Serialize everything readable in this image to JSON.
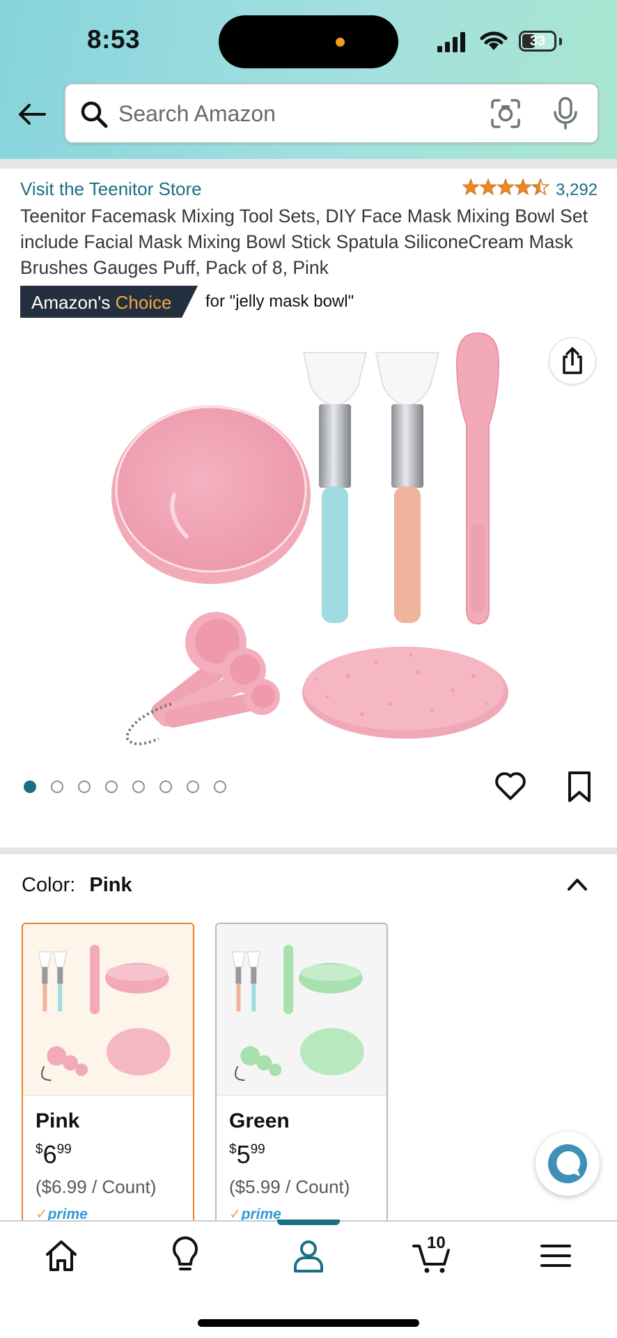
{
  "status_bar": {
    "time": "8:53",
    "battery": "33"
  },
  "search": {
    "placeholder": "Search Amazon"
  },
  "product": {
    "store_link": "Visit the Teenitor Store",
    "rating": 4.5,
    "rating_count": "3,292",
    "title": "Teenitor Facemask Mixing Tool Sets, DIY Face Mask Mixing Bowl Set include Facial Mask Mixing Bowl Stick Spatula SiliconeCream Mask Brushes Gauges Puff, Pack of 8, Pink",
    "badge": {
      "prefix": "Amazon's",
      "highlight": "Choice",
      "for_text": "for \"jelly mask bowl\""
    },
    "image_count": 8,
    "active_image": 0
  },
  "color": {
    "label": "Color:",
    "selected": "Pink",
    "options": [
      {
        "name": "Pink",
        "currency": "$",
        "whole": "6",
        "fraction": "99",
        "unit_price": "($6.99 / Count)",
        "prime": "prime"
      },
      {
        "name": "Green",
        "currency": "$",
        "whole": "5",
        "fraction": "99",
        "unit_price": "($5.99 / Count)",
        "prime": "prime"
      }
    ]
  },
  "nav": {
    "cart_count": "10",
    "active": "account"
  },
  "colors": {
    "accent": "#1a6f84",
    "selected_border": "#e57f2d",
    "badge_bg": "#232f3e",
    "badge_choice": "#f3a847",
    "star": "#e98a29",
    "prime": "#2e9ad6"
  },
  "icons": [
    "back-arrow-icon",
    "search-icon",
    "camera-scan-icon",
    "microphone-icon",
    "share-icon",
    "heart-icon",
    "bookmark-icon",
    "chevron-up-icon",
    "chat-icon",
    "home-icon",
    "lightbulb-icon",
    "account-icon",
    "cart-icon",
    "menu-icon"
  ]
}
